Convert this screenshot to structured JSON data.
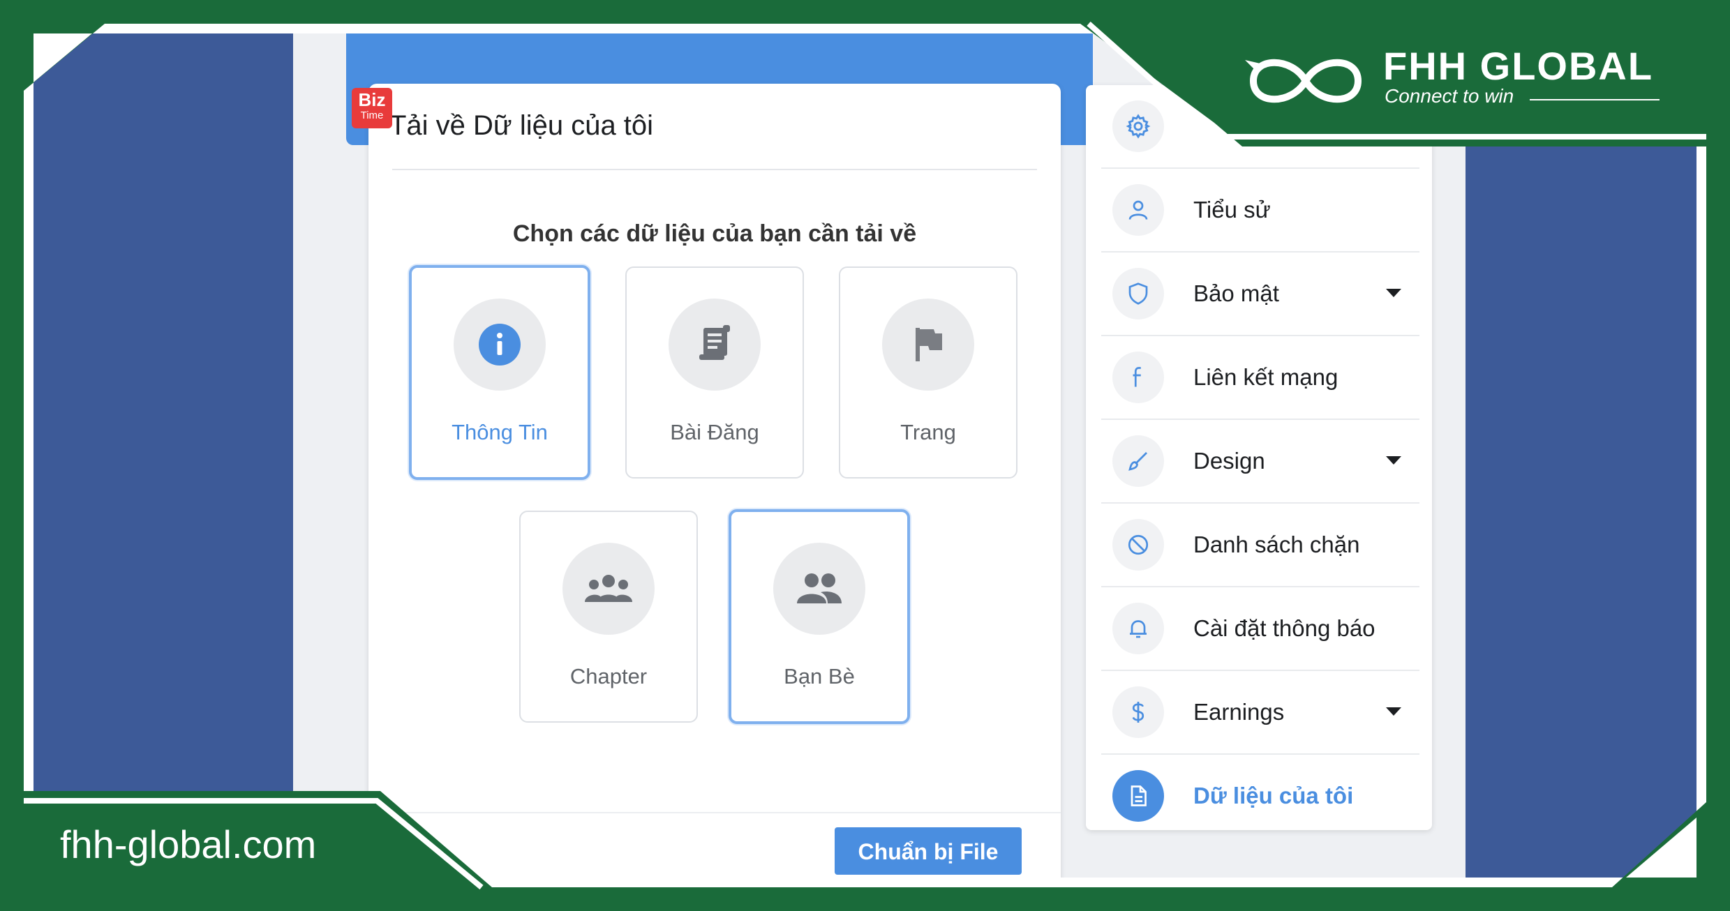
{
  "brand": {
    "name": "FHH GLOBAL",
    "tagline": "Connect to win",
    "domain": "fhh-global.com",
    "badge_line1": "Biz",
    "badge_line2": "Time",
    "frame_color": "#1a6b3a",
    "badge_color": "#e83b3b"
  },
  "theme": {
    "accent": "#4a8ee0",
    "background_blue": "#3d5a98"
  },
  "modal": {
    "title": "Tải về Dữ liệu của tôi",
    "subtitle": "Chọn các dữ liệu của bạn cần tải về",
    "options": [
      {
        "label": "Thông Tin",
        "icon": "info-icon",
        "selected": true
      },
      {
        "label": "Bài Đăng",
        "icon": "document-scroll-icon",
        "selected": false
      },
      {
        "label": "Trang",
        "icon": "flag-icon",
        "selected": false
      },
      {
        "label": "Chapter",
        "icon": "group-icon",
        "selected": false
      },
      {
        "label": "Bạn Bè",
        "icon": "friends-icon",
        "selected": true
      }
    ],
    "prepare_button": "Chuẩn bị File"
  },
  "sidebar": {
    "items": [
      {
        "label": "",
        "icon": "gear-icon"
      },
      {
        "label": "Tiểu sử",
        "icon": "user-icon"
      },
      {
        "label": "Bảo mật",
        "icon": "shield-icon",
        "dropdown": true
      },
      {
        "label": "Liên kết mạng",
        "icon": "facebook-icon"
      },
      {
        "label": "Design",
        "icon": "brush-icon",
        "dropdown": true
      },
      {
        "label": "Danh sách chặn",
        "icon": "block-icon"
      },
      {
        "label": "Cài đặt thông báo",
        "icon": "bell-icon"
      },
      {
        "label": "Earnings",
        "icon": "dollar-icon",
        "dropdown": true
      },
      {
        "label": "Dữ liệu của tôi",
        "icon": "file-icon",
        "active": true
      }
    ]
  }
}
